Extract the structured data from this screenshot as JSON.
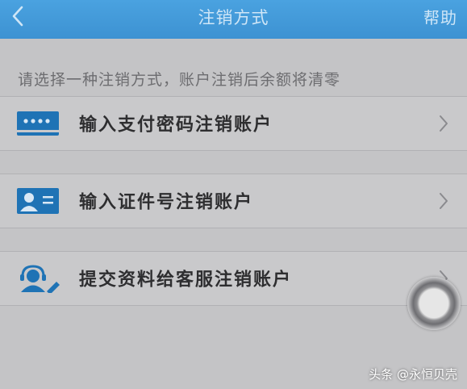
{
  "header": {
    "title": "注销方式",
    "help_label": "帮助"
  },
  "hint": "请选择一种注销方式，账户注销后余额将清零",
  "options": [
    {
      "label": "输入支付密码注销账户",
      "icon": "password-card-icon"
    },
    {
      "label": "输入证件号注销账户",
      "icon": "id-card-icon"
    },
    {
      "label": "提交资料给客服注销账户",
      "icon": "customer-service-icon"
    }
  ],
  "watermark": "头条 @永恒贝壳",
  "colors": {
    "header_bg": "#3d92d2",
    "icon_blue": "#1f73b5",
    "page_bg": "#c4c4c6"
  }
}
